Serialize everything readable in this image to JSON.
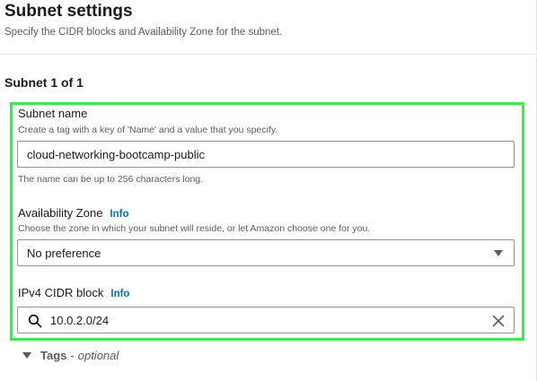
{
  "header": {
    "title": "Subnet settings",
    "description": "Specify the CIDR blocks and Availability Zone for the subnet."
  },
  "subnet": {
    "heading": "Subnet 1 of 1",
    "name": {
      "label": "Subnet name",
      "description": "Create a tag with a key of 'Name' and a value that you specify.",
      "value": "cloud-networking-bootcamp-public",
      "constraint": "The name can be up to 256 characters long."
    },
    "availability_zone": {
      "label": "Availability Zone",
      "info": "Info",
      "description": "Choose the zone in which your subnet will reside, or let Amazon choose one for you.",
      "selected": "No preference"
    },
    "ipv4_cidr": {
      "label": "IPv4 CIDR block",
      "info": "Info",
      "value": "10.0.2.0/24"
    }
  },
  "tags": {
    "label": "Tags",
    "separator": "-",
    "optional": "optional"
  },
  "colors": {
    "highlight": "#1eff3c",
    "link": "#0073bb",
    "text": "#16191f",
    "secondary_text": "#545b64"
  }
}
